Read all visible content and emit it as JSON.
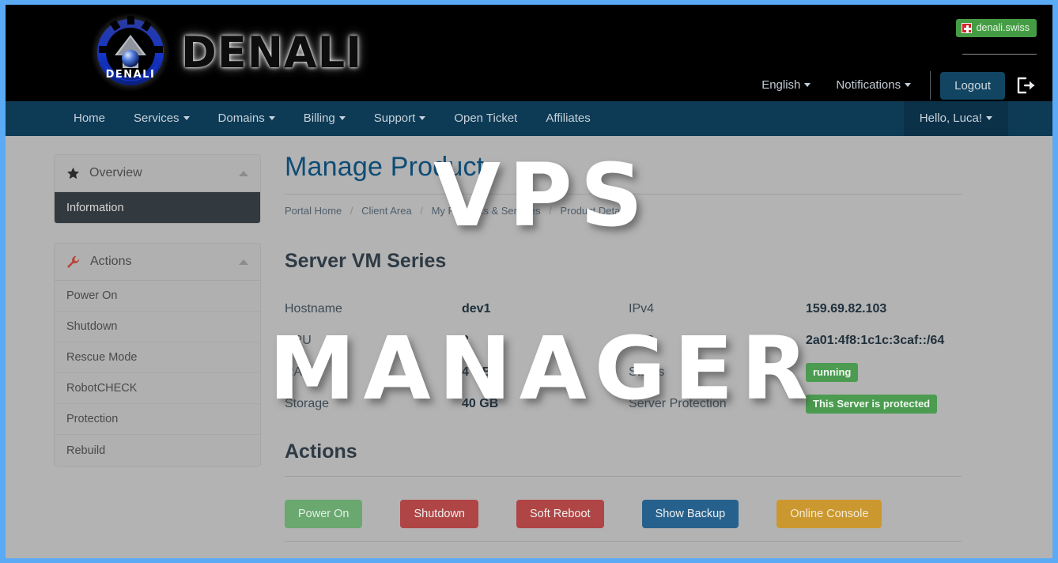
{
  "header": {
    "logo_text": "DENALI",
    "logo_icon": "denali-globe-logo",
    "lang_badge": {
      "icon": "swiss-flag-icon",
      "label": "denali.swiss"
    },
    "links": [
      {
        "label": "English",
        "icon": "chevron-down-icon",
        "has_caret": true
      },
      {
        "label": "Notifications",
        "icon": "chevron-down-icon",
        "has_caret": true
      }
    ],
    "logout_label": "Logout",
    "logout_icon": "sign-out-icon"
  },
  "navbar": {
    "items": [
      {
        "label": "Home",
        "has_caret": false
      },
      {
        "label": "Services",
        "has_caret": true
      },
      {
        "label": "Domains",
        "has_caret": true
      },
      {
        "label": "Billing",
        "has_caret": true
      },
      {
        "label": "Support",
        "has_caret": true
      },
      {
        "label": "Open Ticket",
        "has_caret": false
      },
      {
        "label": "Affiliates",
        "has_caret": false
      }
    ],
    "user_label": "Hello, Luca!"
  },
  "sidebar": {
    "panels": [
      {
        "title": "Overview",
        "icon": "star-icon",
        "collapse_icon": "chevron-up-icon",
        "items": [
          {
            "label": "Information",
            "active": true
          }
        ]
      },
      {
        "title": "Actions",
        "icon": "wrench-icon",
        "collapse_icon": "chevron-up-icon",
        "items": [
          {
            "label": "Power On",
            "active": false
          },
          {
            "label": "Shutdown",
            "active": false
          },
          {
            "label": "Rescue Mode",
            "active": false
          },
          {
            "label": "RobotCHECK",
            "active": false
          },
          {
            "label": "Protection",
            "active": false
          },
          {
            "label": "Rebuild",
            "active": false
          }
        ]
      }
    ]
  },
  "main": {
    "page_title": "Manage Product",
    "breadcrumb": [
      "Portal Home",
      "Client Area",
      "My Products & Services",
      "Product Details"
    ],
    "series_title": "Server VM Series",
    "specs_left": [
      {
        "label": "Hostname",
        "value": "dev1",
        "type": "text"
      },
      {
        "label": "CPU",
        "value": "2",
        "type": "text"
      },
      {
        "label": "RAM",
        "value": "4 GB",
        "type": "text"
      },
      {
        "label": "Storage",
        "value": "40 GB",
        "type": "text"
      }
    ],
    "specs_right": [
      {
        "label": "IPv4",
        "value": "159.69.82.103",
        "type": "text"
      },
      {
        "label": "IPv6",
        "value": "2a01:4f8:1c1c:3caf::/64",
        "type": "text"
      },
      {
        "label": "Status",
        "value": "running",
        "type": "tag"
      },
      {
        "label": "Server Protection",
        "value": "This Server is protected",
        "type": "tag"
      }
    ],
    "actions_title": "Actions",
    "buttons": [
      {
        "label": "Power On",
        "color": "green"
      },
      {
        "label": "Shutdown",
        "color": "red"
      },
      {
        "label": "Soft Reboot",
        "color": "red"
      },
      {
        "label": "Show Backup",
        "color": "blue"
      },
      {
        "label": "Online Console",
        "color": "orange"
      }
    ]
  },
  "watermark": {
    "line1": "VPS",
    "line2": "MANAGER"
  },
  "colors": {
    "frame": "#5aaaf5",
    "header_bg": "#000000",
    "navbar_bg": "#0d3a55",
    "page_bg": "#b3b3b3",
    "title_blue": "#0f4c75",
    "tag_green": "#4b9b50",
    "badge_green": "#449d44",
    "btn_green": "#6aa86f",
    "btn_red": "#b04545",
    "btn_blue": "#26618d",
    "btn_orange": "#cb982f",
    "active_item": "#333a3f"
  }
}
